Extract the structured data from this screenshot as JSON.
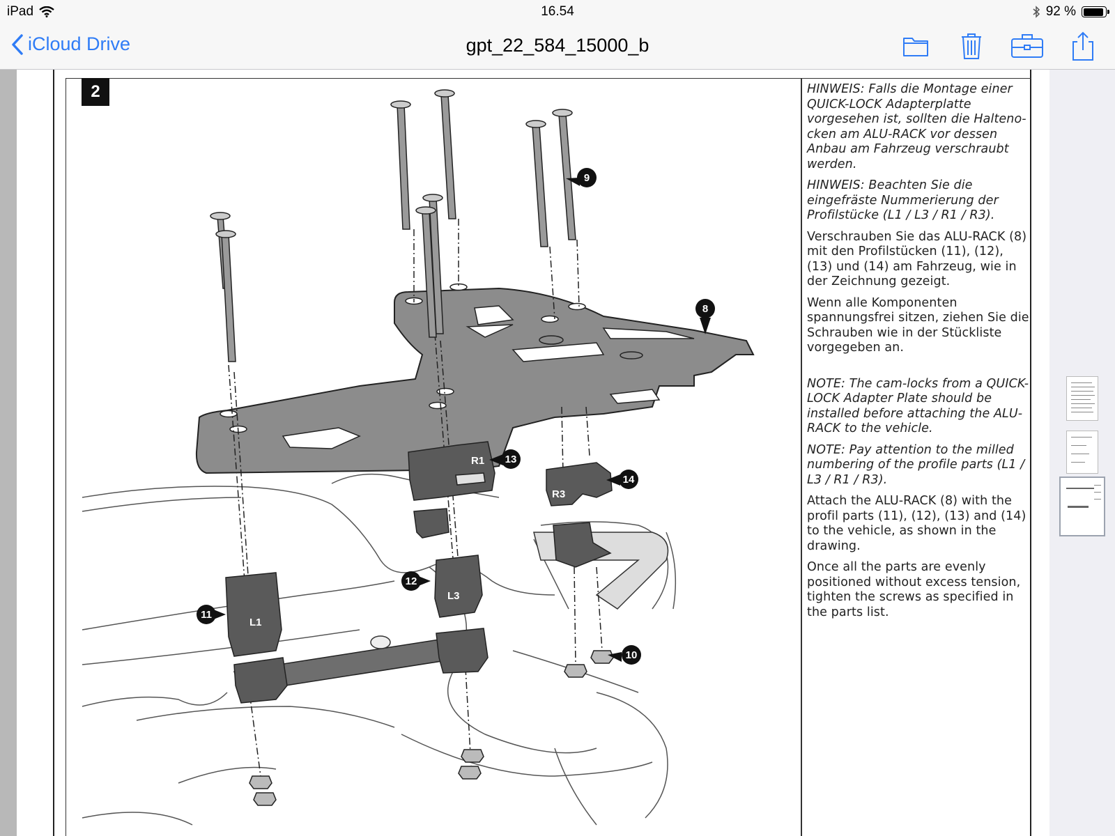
{
  "status_bar": {
    "device": "iPad",
    "time": "16.54",
    "battery": "92 %",
    "battery_level": 0.92
  },
  "nav": {
    "back_label": "iCloud Drive",
    "title": "gpt_22_584_15000_b",
    "icons": [
      "folder-icon",
      "trash-icon",
      "toolbox-icon",
      "share-icon"
    ]
  },
  "document": {
    "step_number": "2",
    "notes": [
      {
        "text": "HINWEIS: Falls die Montage einer QUICK-LOCK Adapterplatte vorgesehen ist, sollten die Halteno-cken am ALU-RACK vor dessen Anbau am Fahrzeug verschraubt werden.",
        "italic": true
      },
      {
        "text": "HINWEIS: Beachten Sie die eingefräste Nummerierung der Profilstücke (L1 / L3 / R1 / R3).",
        "italic": true
      },
      {
        "text": "Verschrauben Sie das ALU-RACK (8) mit den Profilstücken (11), (12), (13) und (14) am Fahrzeug, wie in der Zeichnung gezeigt.",
        "italic": false
      },
      {
        "text": "Wenn alle Komponenten spannungsfrei sitzen, ziehen Sie die Schrauben wie in der Stückliste vorgegeben an.",
        "italic": false
      },
      {
        "text": "NOTE: The cam-locks from a QUICK-LOCK Adapter Plate should be installed before attaching the ALU-RACK to the vehicle.",
        "italic": true
      },
      {
        "text": "NOTE: Pay attention to the milled numbering of the profile parts (L1 / L3 / R1 / R3).",
        "italic": true
      },
      {
        "text": "Attach the ALU-RACK (8) with the profil parts (11), (12), (13) and (14) to the vehicle, as shown in the drawing.",
        "italic": false
      },
      {
        "text": "Once all the parts are evenly positioned without excess tension, tighten the screws as specified in the parts list.",
        "italic": false
      }
    ],
    "callouts": [
      "8",
      "9",
      "10",
      "11",
      "12",
      "13",
      "14"
    ],
    "part_labels": [
      "R1",
      "R3",
      "L1",
      "L3"
    ]
  },
  "thumbnails": {
    "count": 3,
    "active_index": 2
  },
  "colors": {
    "accent": "#2f7cf6",
    "rack_gray": "#8c8c8c",
    "block_gray": "#5a5a5a"
  }
}
